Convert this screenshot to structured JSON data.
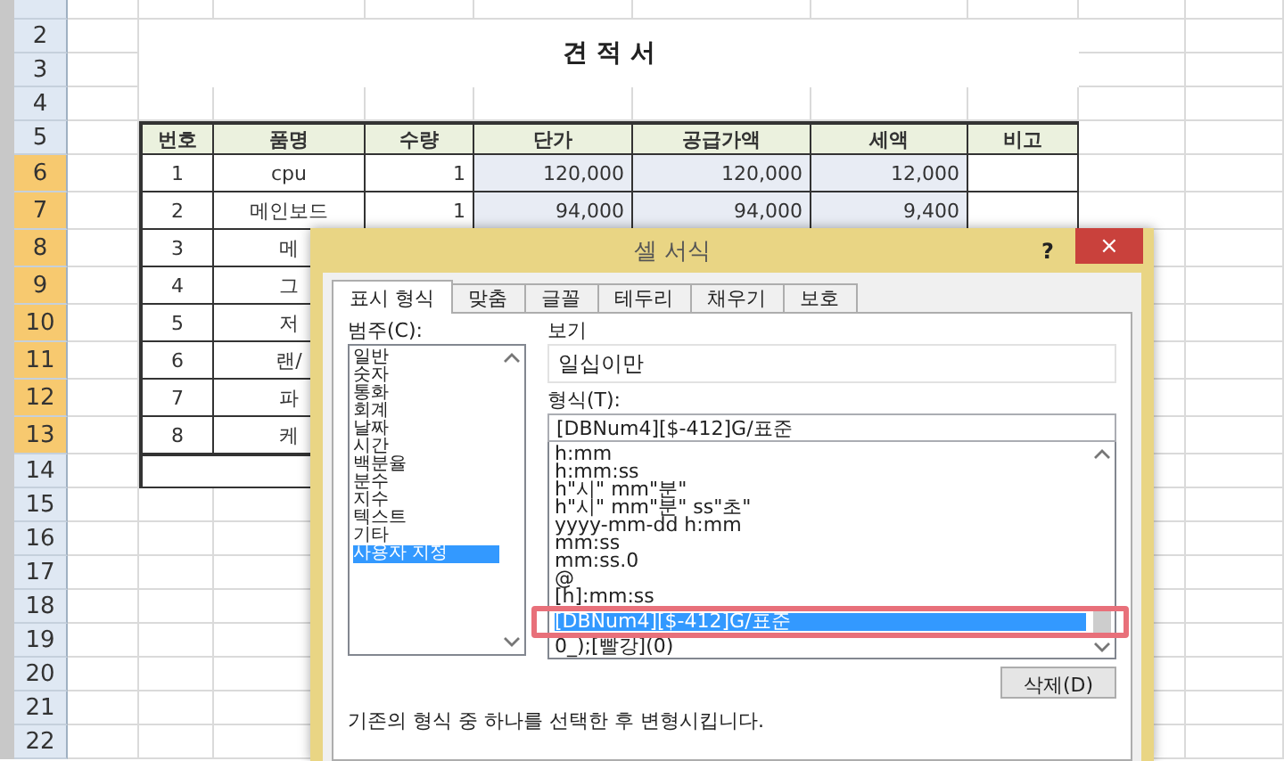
{
  "sheet": {
    "row_headers": [
      {
        "number": "2",
        "selected": false
      },
      {
        "number": "3",
        "selected": false
      },
      {
        "number": "4",
        "selected": false
      },
      {
        "number": "5",
        "selected": false
      },
      {
        "number": "6",
        "selected": true
      },
      {
        "number": "7",
        "selected": true
      },
      {
        "number": "8",
        "selected": true
      },
      {
        "number": "9",
        "selected": true
      },
      {
        "number": "10",
        "selected": true
      },
      {
        "number": "11",
        "selected": true
      },
      {
        "number": "12",
        "selected": true
      },
      {
        "number": "13",
        "selected": true
      },
      {
        "number": "14",
        "selected": false
      },
      {
        "number": "15",
        "selected": false
      },
      {
        "number": "16",
        "selected": false
      },
      {
        "number": "17",
        "selected": false
      },
      {
        "number": "18",
        "selected": false
      },
      {
        "number": "19",
        "selected": false
      },
      {
        "number": "20",
        "selected": false
      },
      {
        "number": "21",
        "selected": false
      },
      {
        "number": "22",
        "selected": false
      }
    ],
    "title": "견 적 서",
    "table": {
      "columns": [
        "번호",
        "품명",
        "수량",
        "단가",
        "공급가액",
        "세액",
        "비고"
      ],
      "rows": [
        {
          "no": "1",
          "item": "cpu",
          "qty": "1",
          "unit_price": "120,000",
          "supply": "120,000",
          "tax": "12,000"
        },
        {
          "no": "2",
          "item": "메인보드",
          "qty": "1",
          "unit_price": "94,000",
          "supply": "94,000",
          "tax": "9,400"
        },
        {
          "no": "3",
          "item": "메"
        },
        {
          "no": "4",
          "item": "그"
        },
        {
          "no": "5",
          "item": "저"
        },
        {
          "no": "6",
          "item": "랜/"
        },
        {
          "no": "7",
          "item": "파"
        },
        {
          "no": "8",
          "item": "케"
        }
      ]
    }
  },
  "dialog": {
    "title": "셀 서식",
    "help": "?",
    "close": "×",
    "tabs": [
      {
        "label": "표시 형식",
        "selected": true
      },
      {
        "label": "맞춤",
        "selected": false
      },
      {
        "label": "글꼴",
        "selected": false
      },
      {
        "label": "테두리",
        "selected": false
      },
      {
        "label": "채우기",
        "selected": false
      },
      {
        "label": "보호",
        "selected": false
      }
    ],
    "category_label": "범주(C):",
    "categories": [
      {
        "label": "일반",
        "selected": false
      },
      {
        "label": "숫자",
        "selected": false
      },
      {
        "label": "통화",
        "selected": false
      },
      {
        "label": "회계",
        "selected": false
      },
      {
        "label": "날짜",
        "selected": false
      },
      {
        "label": "시간",
        "selected": false
      },
      {
        "label": "백분율",
        "selected": false
      },
      {
        "label": "분수",
        "selected": false
      },
      {
        "label": "지수",
        "selected": false
      },
      {
        "label": "텍스트",
        "selected": false
      },
      {
        "label": "기타",
        "selected": false
      },
      {
        "label": "사용자 지정",
        "selected": true
      }
    ],
    "preview_label": "보기",
    "preview": "일십이만",
    "format_label": "형식(T):",
    "format_value": "[DBNum4][$-412]G/표준",
    "formats": [
      {
        "label": "h:mm",
        "selected": false,
        "annotated": false
      },
      {
        "label": "h:mm:ss",
        "selected": false,
        "annotated": false
      },
      {
        "label": "h\"시\" mm\"분\"",
        "selected": false,
        "annotated": false
      },
      {
        "label": "h\"시\" mm\"분\" ss\"초\"",
        "selected": false,
        "annotated": false
      },
      {
        "label": "yyyy-mm-dd h:mm",
        "selected": false,
        "annotated": false
      },
      {
        "label": "mm:ss",
        "selected": false,
        "annotated": false
      },
      {
        "label": "mm:ss.0",
        "selected": false,
        "annotated": false
      },
      {
        "label": "@",
        "selected": false,
        "annotated": false
      },
      {
        "label": "[h]:mm:ss",
        "selected": false,
        "annotated": false
      },
      {
        "label": "[DBNum4][$-412]G/표준",
        "selected": true,
        "annotated": true
      },
      {
        "label": "0_);[빨강](0)",
        "selected": false,
        "annotated": false
      }
    ],
    "delete_button": "삭제(D)",
    "hint": "기존의 형식 중 하나를 선택한 후 변형시킵니다."
  }
}
